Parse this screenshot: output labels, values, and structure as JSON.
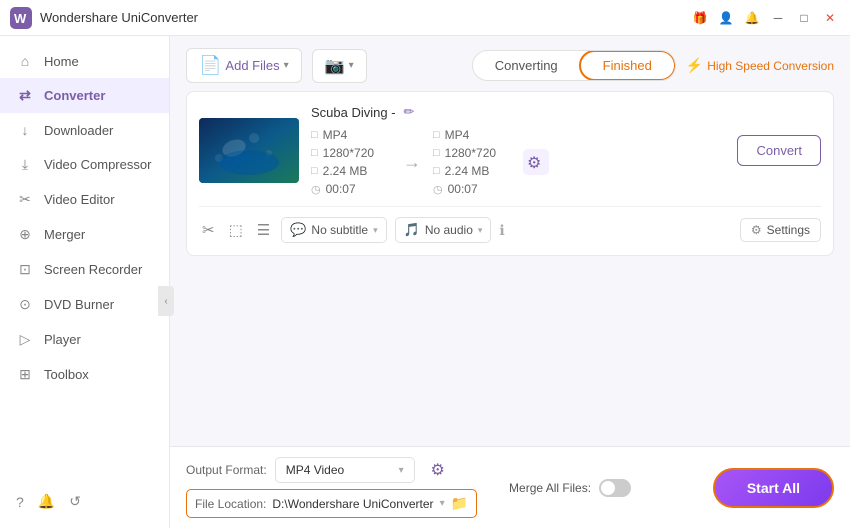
{
  "app": {
    "title": "Wondershare UniConverter",
    "logo_color": "#7b5ea7"
  },
  "titlebar": {
    "title": "Wondershare UniConverter",
    "controls": [
      "gift",
      "user",
      "bell",
      "minimize",
      "maximize",
      "close"
    ]
  },
  "sidebar": {
    "items": [
      {
        "id": "home",
        "label": "Home",
        "icon": "⌂"
      },
      {
        "id": "converter",
        "label": "Converter",
        "icon": "⇄",
        "active": true
      },
      {
        "id": "downloader",
        "label": "Downloader",
        "icon": "↓"
      },
      {
        "id": "video-compressor",
        "label": "Video Compressor",
        "icon": "⤓"
      },
      {
        "id": "video-editor",
        "label": "Video Editor",
        "icon": "✂"
      },
      {
        "id": "merger",
        "label": "Merger",
        "icon": "⊕"
      },
      {
        "id": "screen-recorder",
        "label": "Screen Recorder",
        "icon": "⊡"
      },
      {
        "id": "dvd-burner",
        "label": "DVD Burner",
        "icon": "⊙"
      },
      {
        "id": "player",
        "label": "Player",
        "icon": "▷"
      },
      {
        "id": "toolbox",
        "label": "Toolbox",
        "icon": "⊞"
      }
    ],
    "bottom_icons": [
      "?",
      "🔔",
      "↺"
    ]
  },
  "toolbar": {
    "add_button_label": "Add Files",
    "camera_button_label": "Add Screen Recording",
    "tabs": [
      {
        "id": "converting",
        "label": "Converting",
        "active": false
      },
      {
        "id": "finished",
        "label": "Finished",
        "active": true
      }
    ],
    "high_speed_label": "High Speed Conversion"
  },
  "file_item": {
    "name": "Scuba Diving -",
    "source": {
      "format": "MP4",
      "resolution": "1280*720",
      "size": "2.24 MB",
      "duration": "00:07"
    },
    "target": {
      "format": "MP4",
      "resolution": "1280*720",
      "size": "2.24 MB",
      "duration": "00:07"
    },
    "subtitle": "No subtitle",
    "audio": "No audio",
    "convert_btn": "Convert",
    "settings_btn": "Settings"
  },
  "bottom_bar": {
    "output_format_label": "Output Format:",
    "output_format_value": "MP4 Video",
    "file_location_label": "File Location:",
    "file_location_path": "D:\\Wondershare UniConverter",
    "merge_files_label": "Merge All Files:",
    "start_all_label": "Start All"
  }
}
